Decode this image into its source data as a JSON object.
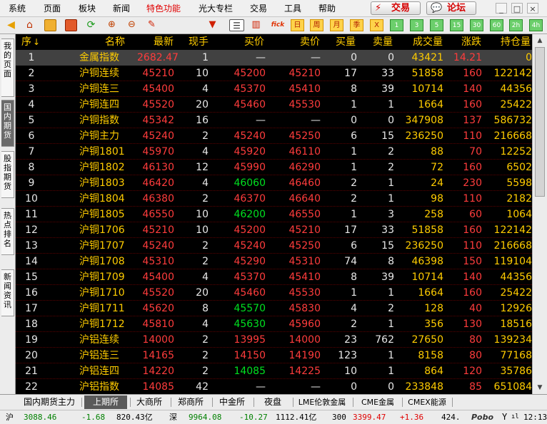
{
  "menubar": {
    "items": [
      "系统",
      "页面",
      "板块",
      "新闻",
      "特色功能",
      "光大专栏",
      "交易",
      "工具",
      "帮助"
    ],
    "trade_button": "交易",
    "forum_button": "论坛",
    "window_buttons": [
      "_",
      "□",
      "×"
    ]
  },
  "toolbar": {
    "icons": [
      "back-arrow-icon",
      "home-icon",
      "orders-icon",
      "grid-view-icon",
      "refresh-icon",
      "zoom-in-icon",
      "zoom-out-icon",
      "pencil-icon",
      "filter-icon",
      "list-view-icon",
      "bar-chart-icon",
      "fenshi-icon"
    ],
    "fenshi_label": "fick",
    "period_labels": [
      "日",
      "周",
      "月",
      "季",
      "X",
      "1",
      "3",
      "5",
      "15",
      "30",
      "60",
      "2h",
      "4h"
    ]
  },
  "side_tabs": [
    "我的页面",
    "国内期货",
    "股指期货",
    "热点排名",
    "新闻资讯"
  ],
  "columns": [
    "序",
    "名称",
    "最新",
    "现手",
    "买价",
    "卖价",
    "买量",
    "卖量",
    "成交量",
    "涨跌",
    "持仓量"
  ],
  "sort_indicator": "↓",
  "rows": [
    {
      "no": "1",
      "name": "金属指数",
      "last": "2682.47",
      "lastC": "red",
      "hand": "1",
      "bid": "—",
      "bidC": "white",
      "ask": "—",
      "askC": "white",
      "bq": "0",
      "aq": "0",
      "vol": "43421",
      "chg": "14.21",
      "oi": "0",
      "selected": true
    },
    {
      "no": "2",
      "name": "沪铜连续",
      "last": "45210",
      "lastC": "red",
      "hand": "10",
      "bid": "45200",
      "bidC": "red",
      "ask": "45210",
      "askC": "red",
      "bq": "17",
      "aq": "33",
      "vol": "51858",
      "chg": "160",
      "oi": "122142"
    },
    {
      "no": "3",
      "name": "沪铜连三",
      "last": "45400",
      "lastC": "red",
      "hand": "4",
      "bid": "45370",
      "bidC": "red",
      "ask": "45410",
      "askC": "red",
      "bq": "8",
      "aq": "39",
      "vol": "10714",
      "chg": "140",
      "oi": "44356"
    },
    {
      "no": "4",
      "name": "沪铜连四",
      "last": "45520",
      "lastC": "red",
      "hand": "20",
      "bid": "45460",
      "bidC": "red",
      "ask": "45530",
      "askC": "red",
      "bq": "1",
      "aq": "1",
      "vol": "1664",
      "chg": "160",
      "oi": "25422"
    },
    {
      "no": "5",
      "name": "沪铜指数",
      "last": "45342",
      "lastC": "red",
      "hand": "16",
      "bid": "—",
      "bidC": "white",
      "ask": "—",
      "askC": "white",
      "bq": "0",
      "aq": "0",
      "vol": "347908",
      "chg": "137",
      "oi": "586732"
    },
    {
      "no": "6",
      "name": "沪铜主力",
      "last": "45240",
      "lastC": "red",
      "hand": "2",
      "bid": "45240",
      "bidC": "red",
      "ask": "45250",
      "askC": "red",
      "bq": "6",
      "aq": "15",
      "vol": "236250",
      "chg": "110",
      "oi": "216668"
    },
    {
      "no": "7",
      "name": "沪铜1801",
      "last": "45970",
      "lastC": "red",
      "hand": "4",
      "bid": "45920",
      "bidC": "red",
      "ask": "46110",
      "askC": "red",
      "bq": "1",
      "aq": "2",
      "vol": "88",
      "chg": "70",
      "oi": "12252"
    },
    {
      "no": "8",
      "name": "沪铜1802",
      "last": "46130",
      "lastC": "red",
      "hand": "12",
      "bid": "45990",
      "bidC": "red",
      "ask": "46290",
      "askC": "red",
      "bq": "1",
      "aq": "2",
      "vol": "72",
      "chg": "160",
      "oi": "6502"
    },
    {
      "no": "9",
      "name": "沪铜1803",
      "last": "46420",
      "lastC": "red",
      "hand": "4",
      "bid": "46060",
      "bidC": "green",
      "ask": "46460",
      "askC": "red",
      "bq": "2",
      "aq": "1",
      "vol": "24",
      "chg": "230",
      "oi": "5598"
    },
    {
      "no": "10",
      "name": "沪铜1804",
      "last": "46380",
      "lastC": "red",
      "hand": "2",
      "bid": "46370",
      "bidC": "red",
      "ask": "46640",
      "askC": "red",
      "bq": "2",
      "aq": "1",
      "vol": "98",
      "chg": "110",
      "oi": "2182"
    },
    {
      "no": "11",
      "name": "沪铜1805",
      "last": "46550",
      "lastC": "red",
      "hand": "10",
      "bid": "46200",
      "bidC": "green",
      "ask": "46550",
      "askC": "red",
      "bq": "1",
      "aq": "3",
      "vol": "258",
      "chg": "60",
      "oi": "1064"
    },
    {
      "no": "12",
      "name": "沪铜1706",
      "last": "45210",
      "lastC": "red",
      "hand": "10",
      "bid": "45200",
      "bidC": "red",
      "ask": "45210",
      "askC": "red",
      "bq": "17",
      "aq": "33",
      "vol": "51858",
      "chg": "160",
      "oi": "122142"
    },
    {
      "no": "13",
      "name": "沪铜1707",
      "last": "45240",
      "lastC": "red",
      "hand": "2",
      "bid": "45240",
      "bidC": "red",
      "ask": "45250",
      "askC": "red",
      "bq": "6",
      "aq": "15",
      "vol": "236250",
      "chg": "110",
      "oi": "216668"
    },
    {
      "no": "14",
      "name": "沪铜1708",
      "last": "45310",
      "lastC": "red",
      "hand": "2",
      "bid": "45290",
      "bidC": "red",
      "ask": "45310",
      "askC": "red",
      "bq": "74",
      "aq": "8",
      "vol": "46398",
      "chg": "150",
      "oi": "119104"
    },
    {
      "no": "15",
      "name": "沪铜1709",
      "last": "45400",
      "lastC": "red",
      "hand": "4",
      "bid": "45370",
      "bidC": "red",
      "ask": "45410",
      "askC": "red",
      "bq": "8",
      "aq": "39",
      "vol": "10714",
      "chg": "140",
      "oi": "44356"
    },
    {
      "no": "16",
      "name": "沪铜1710",
      "last": "45520",
      "lastC": "red",
      "hand": "20",
      "bid": "45460",
      "bidC": "red",
      "ask": "45530",
      "askC": "red",
      "bq": "1",
      "aq": "1",
      "vol": "1664",
      "chg": "160",
      "oi": "25422"
    },
    {
      "no": "17",
      "name": "沪铜1711",
      "last": "45620",
      "lastC": "red",
      "hand": "8",
      "bid": "45570",
      "bidC": "green",
      "ask": "45830",
      "askC": "red",
      "bq": "4",
      "aq": "2",
      "vol": "128",
      "chg": "40",
      "oi": "12926"
    },
    {
      "no": "18",
      "name": "沪铜1712",
      "last": "45810",
      "lastC": "red",
      "hand": "4",
      "bid": "45630",
      "bidC": "green",
      "ask": "45960",
      "askC": "red",
      "bq": "2",
      "aq": "1",
      "vol": "356",
      "chg": "130",
      "oi": "18516"
    },
    {
      "no": "19",
      "name": "沪铝连续",
      "last": "14000",
      "lastC": "red",
      "hand": "2",
      "bid": "13995",
      "bidC": "red",
      "ask": "14000",
      "askC": "red",
      "bq": "23",
      "aq": "762",
      "vol": "27650",
      "chg": "80",
      "oi": "139234"
    },
    {
      "no": "20",
      "name": "沪铝连三",
      "last": "14165",
      "lastC": "red",
      "hand": "2",
      "bid": "14150",
      "bidC": "red",
      "ask": "14190",
      "askC": "red",
      "bq": "123",
      "aq": "1",
      "vol": "8158",
      "chg": "80",
      "oi": "77168"
    },
    {
      "no": "21",
      "name": "沪铝连四",
      "last": "14220",
      "lastC": "red",
      "hand": "2",
      "bid": "14085",
      "bidC": "green",
      "ask": "14225",
      "askC": "red",
      "bq": "10",
      "aq": "1",
      "vol": "864",
      "chg": "120",
      "oi": "35786"
    },
    {
      "no": "22",
      "name": "沪铝指数",
      "last": "14085",
      "lastC": "red",
      "hand": "42",
      "bid": "—",
      "bidC": "white",
      "ask": "—",
      "askC": "white",
      "bq": "0",
      "aq": "0",
      "vol": "233848",
      "chg": "85",
      "oi": "651084"
    }
  ],
  "bottom_tabs": [
    "国内期货主力",
    "上期所",
    "大商所",
    "郑商所",
    "中金所",
    "夜盘",
    "LME伦敦金属",
    "CME金属",
    "CMEX能源"
  ],
  "active_bottom_tab": 1,
  "status": {
    "sh_label": "沪",
    "sh_value": "3088.46",
    "sh_change": "-1.68",
    "sh_amount": "820.43亿",
    "sz_label": "深",
    "sz_value": "9964.08",
    "sz_change": "-10.27",
    "sz_amount": "1112.41亿",
    "i300_label": "300",
    "i300_value": "3399.47",
    "i300_change": "+1.36",
    "i300_amount": "424.",
    "brand": "Pobo",
    "time": "12:13"
  },
  "colors": {
    "header": "#ffcc00",
    "up": "#ff3c3c",
    "down": "#00e020",
    "plain": "#e8e8e8",
    "selected_row": "#414141"
  }
}
